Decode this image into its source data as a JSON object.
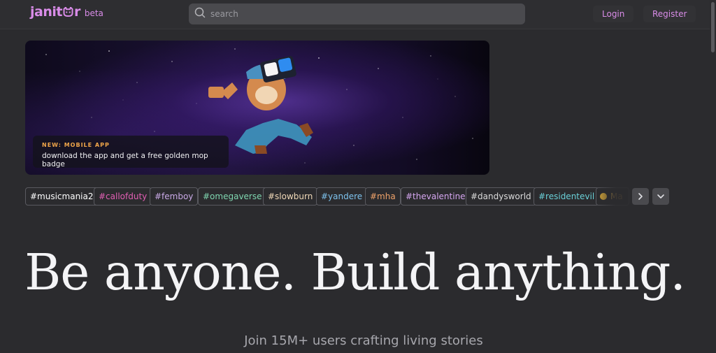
{
  "header": {
    "logo_text_left": "janit",
    "logo_text_right": "r",
    "beta_label": "beta",
    "search_placeholder": "search",
    "login_label": "Login",
    "register_label": "Register"
  },
  "banner": {
    "tag": "NEW: MOBILE APP",
    "text": "download the app and get a free golden mop badge"
  },
  "tags": [
    {
      "label": "#musicmania2",
      "color": "#ffffff"
    },
    {
      "label": "#callofduty",
      "color": "#e25fb4"
    },
    {
      "label": "#femboy",
      "color": "#c9a9e6"
    },
    {
      "label": "#omegaverse",
      "color": "#7fd6b0"
    },
    {
      "label": "#slowburn",
      "color": "#f0d9b8"
    },
    {
      "label": "#yandere",
      "color": "#7ec3ee"
    },
    {
      "label": "#mha",
      "color": "#f0a36a"
    },
    {
      "label": "#thevalentine",
      "color": "#d5a6f0"
    },
    {
      "label": "#dandysworld",
      "color": "#dcdcdc"
    },
    {
      "label": "#residentevil",
      "color": "#6ad0d8"
    },
    {
      "label": "Ma",
      "color": "#d8a94c"
    }
  ],
  "hero": {
    "title": "Be anyone. Build anything.",
    "subtitle": "Join 15M+ users crafting living stories"
  },
  "colors": {
    "accent": "#d98ce8",
    "background": "#2b2b2e",
    "badge_orange": "#f0a64a"
  },
  "icons": [
    "search-icon",
    "cat-logo-icon",
    "arrow-up-right-icon",
    "chevron-right-icon",
    "chevron-down-icon",
    "emoji-icon"
  ]
}
